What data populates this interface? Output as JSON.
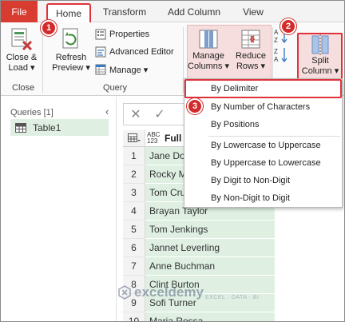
{
  "tabs": {
    "file": "File",
    "home": "Home",
    "transform": "Transform",
    "add_column": "Add Column",
    "view": "View"
  },
  "ribbon": {
    "close_load": [
      "Close &",
      "Load ▾"
    ],
    "close_group": "Close",
    "refresh_preview": [
      "Refresh",
      "Preview ▾"
    ],
    "properties": "Properties",
    "advanced_editor": "Advanced Editor",
    "manage": "Manage ▾",
    "query_group": "Query",
    "manage_columns": [
      "Manage",
      "Columns ▾"
    ],
    "reduce_rows": [
      "Reduce",
      "Rows ▾"
    ],
    "split_column": [
      "Split",
      "Column ▾"
    ]
  },
  "badges": [
    "1",
    "2",
    "3"
  ],
  "queries_pane": {
    "heading": "Queries [1]",
    "collapse": "‹",
    "item": "Table1"
  },
  "column_header": {
    "type_top": "ABC",
    "type_bottom": "123",
    "name": "Full"
  },
  "rows": [
    {
      "index": "1",
      "value": "Jane Doe"
    },
    {
      "index": "2",
      "value": "Rocky M"
    },
    {
      "index": "3",
      "value": "Tom Cru"
    },
    {
      "index": "4",
      "value": "Brayan Taylor"
    },
    {
      "index": "5",
      "value": "Tom Jenkings"
    },
    {
      "index": "6",
      "value": "Jannet Leverling"
    },
    {
      "index": "7",
      "value": "Anne Buchman"
    },
    {
      "index": "8",
      "value": "Clint Burton"
    },
    {
      "index": "9",
      "value": "Sofi Turner"
    },
    {
      "index": "10",
      "value": "Maria Rossa"
    }
  ],
  "split_menu": [
    "By Delimiter",
    "By Number of Characters",
    "By Positions",
    "By Lowercase to Uppercase",
    "By Uppercase to Lowercase",
    "By Digit to Non-Digit",
    "By Non-Digit to Digit"
  ],
  "watermark": {
    "name": "exceldemy",
    "tagline": "EXCEL · DATA · BI"
  },
  "colors": {
    "file_tab": "#d83b2f",
    "highlight_red": "#e0323b",
    "badge": "#d32a2a",
    "table_green": "#dff0e3"
  }
}
